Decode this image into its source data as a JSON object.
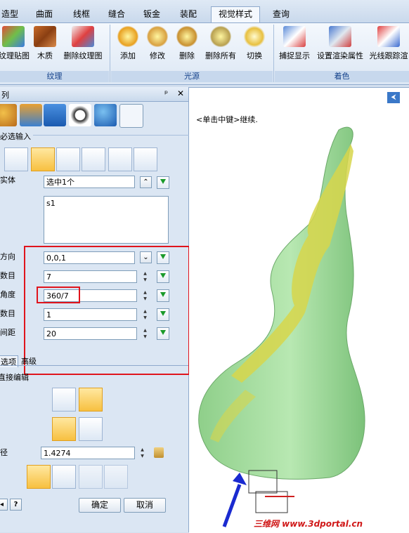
{
  "tabs": [
    "造型",
    "曲面",
    "线框",
    "缝合",
    "钣金",
    "装配",
    "视觉样式",
    "查询"
  ],
  "active_tab": "视觉样式",
  "ribbon": {
    "groups": [
      {
        "title": "纹理",
        "buttons": [
          "纹理贴图",
          "木质",
          "删除纹理图"
        ]
      },
      {
        "title": "光源",
        "buttons": [
          "添加",
          "修改",
          "删除",
          "删除所有",
          "切换"
        ]
      },
      {
        "title": "着色",
        "buttons": [
          "捕捉显示",
          "设置渲染属性",
          "光线跟踪渲"
        ]
      }
    ]
  },
  "panel": {
    "title": "列",
    "pin": "ᵖ",
    "close": "✕",
    "section_required": "必选输入",
    "fields": {
      "entity": {
        "label": "实体",
        "value": "选中1个"
      },
      "list_value": "s1",
      "direction": {
        "label": "方向",
        "value": "0,0,1"
      },
      "count": {
        "label": "数目",
        "value": "7"
      },
      "angle": {
        "label": "角度",
        "value": "360/7"
      },
      "count2": {
        "label": "数目",
        "value": "1"
      },
      "spacing": {
        "label": "间距",
        "value": "20"
      }
    },
    "tabs_bottom": [
      "选项",
      "高级"
    ],
    "direct_edit": "直接编辑",
    "diameter": {
      "label": "径",
      "value": "1.4274"
    },
    "help_icon": "?",
    "ok": "确定",
    "cancel": "取消"
  },
  "viewport": {
    "hint": "<单击中键>继续.",
    "watermark": "三维网 www.3dportal.cn"
  },
  "colors": {
    "highlight_red": "#e0141c",
    "vase_green": "#a6e0a0",
    "twist_yellow": "#d7d64b",
    "accent_blue": "#15428b"
  }
}
